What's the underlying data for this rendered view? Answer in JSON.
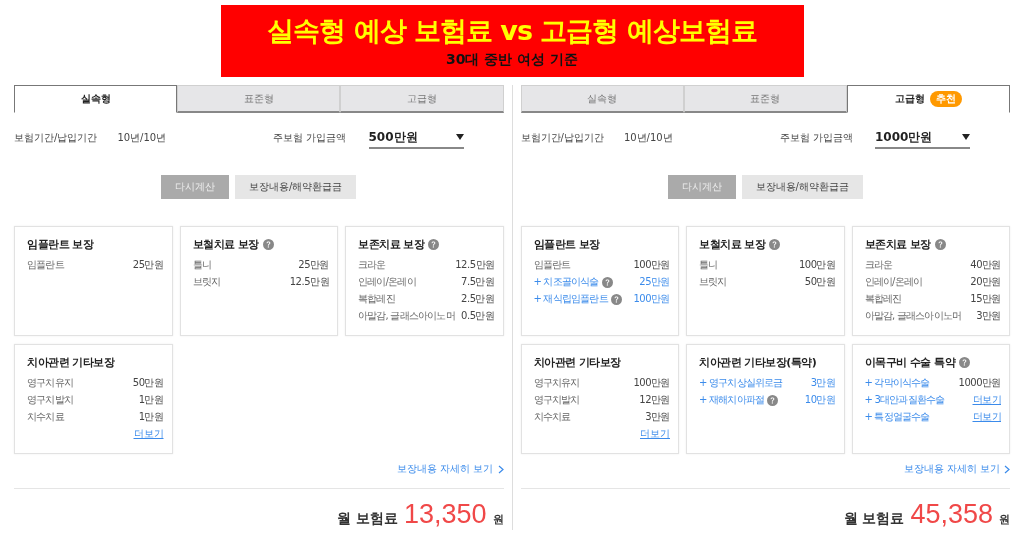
{
  "banner": {
    "title": "실속형 예상 보험료 vs 고급형 예상보험료",
    "subtitle": "30대 중반 여성 기준"
  },
  "panels": [
    {
      "tabs": [
        {
          "label": "실속형",
          "selected": true
        },
        {
          "label": "표준형",
          "selected": false
        },
        {
          "label": "고급형",
          "selected": false
        }
      ],
      "period": {
        "label": "보험기간/납입기간",
        "value": "10년/10년"
      },
      "amount": {
        "label": "주보험 가입금액",
        "value": "500만원"
      },
      "buttons": [
        {
          "label": "다시계산",
          "kind": "recalc"
        },
        {
          "label": "보장내용/해약환급금",
          "kind": "detail"
        }
      ],
      "cards": [
        {
          "title": "임플란트 보장",
          "help": false,
          "rows": [
            {
              "kind": "base",
              "label": "임플란트",
              "help": false,
              "value": "25만원",
              "accent": false
            }
          ]
        },
        {
          "title": "보철치료 보장",
          "help": true,
          "rows": [
            {
              "kind": "base",
              "label": "틀니",
              "help": false,
              "value": "25만원",
              "accent": false
            },
            {
              "kind": "base",
              "label": "브릿지",
              "help": false,
              "value": "12.5만원",
              "accent": false
            }
          ]
        },
        {
          "title": "보존치료 보장",
          "help": true,
          "rows": [
            {
              "kind": "base",
              "label": "크라운",
              "help": false,
              "value": "12.5만원",
              "accent": false
            },
            {
              "kind": "base",
              "label": "인레이/온레이",
              "help": false,
              "value": "7.5만원",
              "accent": false
            },
            {
              "kind": "base",
              "label": "복합레진",
              "help": false,
              "value": "2.5만원",
              "accent": false
            },
            {
              "kind": "base",
              "label": "아말감, 글래스아이노머",
              "help": false,
              "value": "0.5만원",
              "accent": false
            }
          ]
        },
        {
          "title": "치아관련 기타보장",
          "help": false,
          "rows": [
            {
              "kind": "base",
              "label": "영구치유지",
              "help": false,
              "value": "50만원",
              "accent": false
            },
            {
              "kind": "base",
              "label": "영구치발치",
              "help": false,
              "value": "1만원",
              "accent": false
            },
            {
              "kind": "base",
              "label": "치수치료",
              "help": false,
              "value": "1만원",
              "accent": false
            }
          ],
          "more": "더보기"
        }
      ],
      "detail_link": "보장내용 자세히 보기",
      "premium": {
        "label": "월 보험료",
        "amount": "13,350",
        "unit": "원"
      }
    },
    {
      "tabs": [
        {
          "label": "실속형",
          "selected": false
        },
        {
          "label": "표준형",
          "selected": false
        },
        {
          "label": "고급형",
          "selected": true,
          "badge": "추천"
        }
      ],
      "period": {
        "label": "보험기간/납입기간",
        "value": "10년/10년"
      },
      "amount": {
        "label": "주보험 가입금액",
        "value": "1000만원"
      },
      "buttons": [
        {
          "label": "다시계산",
          "kind": "recalc"
        },
        {
          "label": "보장내용/해약환급금",
          "kind": "detail"
        }
      ],
      "cards": [
        {
          "title": "임플란트 보장",
          "help": false,
          "rows": [
            {
              "kind": "base",
              "label": "임플란트",
              "help": false,
              "value": "100만원",
              "accent": false
            },
            {
              "kind": "rider",
              "label": "+ 치조골이식술",
              "help": true,
              "value": "25만원",
              "accent": true
            },
            {
              "kind": "rider",
              "label": "+ 재식립임플란트",
              "help": true,
              "value": "100만원",
              "accent": true
            }
          ]
        },
        {
          "title": "보철치료 보장",
          "help": true,
          "rows": [
            {
              "kind": "base",
              "label": "틀니",
              "help": false,
              "value": "100만원",
              "accent": false
            },
            {
              "kind": "base",
              "label": "브릿지",
              "help": false,
              "value": "50만원",
              "accent": false
            }
          ]
        },
        {
          "title": "보존치료 보장",
          "help": true,
          "rows": [
            {
              "kind": "base",
              "label": "크라운",
              "help": false,
              "value": "40만원",
              "accent": false
            },
            {
              "kind": "base",
              "label": "인레이/온레이",
              "help": false,
              "value": "20만원",
              "accent": false
            },
            {
              "kind": "base",
              "label": "복합레진",
              "help": false,
              "value": "15만원",
              "accent": false
            },
            {
              "kind": "base",
              "label": "아말감, 글래스아이노머",
              "help": false,
              "value": "3만원",
              "accent": false
            }
          ]
        },
        {
          "title": "치아관련 기타보장",
          "help": false,
          "rows": [
            {
              "kind": "base",
              "label": "영구치유지",
              "help": false,
              "value": "100만원",
              "accent": false
            },
            {
              "kind": "base",
              "label": "영구치발치",
              "help": false,
              "value": "12만원",
              "accent": false
            },
            {
              "kind": "base",
              "label": "치수치료",
              "help": false,
              "value": "3만원",
              "accent": false
            }
          ],
          "more": "더보기"
        },
        {
          "title": "치아관련 기타보장(특약)",
          "help": false,
          "rows": [
            {
              "kind": "rider",
              "label": "+ 영구치상실위로금",
              "help": false,
              "value": "3만원",
              "accent": true
            },
            {
              "kind": "rider",
              "label": "+ 재해치아파절",
              "help": true,
              "value": "10만원",
              "accent": true
            }
          ]
        },
        {
          "title": "이목구비 수술 특약",
          "help": true,
          "rows": [
            {
              "kind": "rider",
              "label": "+ 각막이식수술",
              "help": false,
              "value": "1000만원",
              "accent": false,
              "link": false
            },
            {
              "kind": "rider",
              "label": "+ 3대안과질환수술",
              "help": false,
              "value": "더보기",
              "link": true
            },
            {
              "kind": "rider",
              "label": "+ 특정얼굴수술",
              "help": false,
              "value": "더보기",
              "link": true
            }
          ]
        }
      ],
      "detail_link": "보장내용 자세히 보기",
      "premium": {
        "label": "월 보험료",
        "amount": "45,358",
        "unit": "원"
      }
    }
  ]
}
